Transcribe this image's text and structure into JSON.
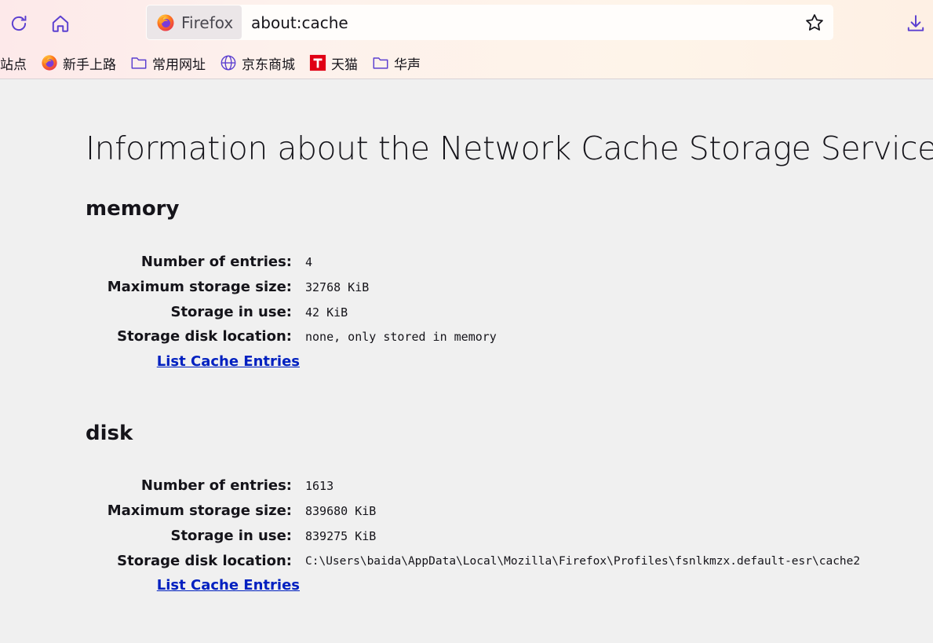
{
  "toolbar": {
    "reload_icon": "reload-icon",
    "home_icon": "home-icon",
    "identity_label": "Firefox",
    "url": "about:cache",
    "bookmark_star_icon": "star-icon",
    "download_icon": "download-icon",
    "accent_color": "#5b3fd0"
  },
  "bookmarks": [
    {
      "label": "站点",
      "icon": "none"
    },
    {
      "label": "新手上路",
      "icon": "firefox-icon"
    },
    {
      "label": "常用网址",
      "icon": "folder-icon"
    },
    {
      "label": "京东商城",
      "icon": "globe-icon"
    },
    {
      "label": "天猫",
      "icon": "tmall-icon"
    },
    {
      "label": "华声",
      "icon": "folder-icon"
    }
  ],
  "page": {
    "title": "Information about the Network Cache Storage Service",
    "sections": [
      {
        "heading": "memory",
        "rows": [
          {
            "label": "Number of entries:",
            "value": "4"
          },
          {
            "label": "Maximum storage size:",
            "value": "32768 KiB"
          },
          {
            "label": "Storage in use:",
            "value": "42 KiB"
          },
          {
            "label": "Storage disk location:",
            "value": "none, only stored in memory"
          }
        ],
        "link": "List Cache Entries"
      },
      {
        "heading": "disk",
        "rows": [
          {
            "label": "Number of entries:",
            "value": "1613"
          },
          {
            "label": "Maximum storage size:",
            "value": "839680 KiB"
          },
          {
            "label": "Storage in use:",
            "value": "839275 KiB"
          },
          {
            "label": "Storage disk location:",
            "value": "C:\\Users\\baida\\AppData\\Local\\Mozilla\\Firefox\\Profiles\\fsnlkmzx.default-esr\\cache2"
          }
        ],
        "link": "List Cache Entries"
      }
    ],
    "link_color": "#0020c0"
  }
}
